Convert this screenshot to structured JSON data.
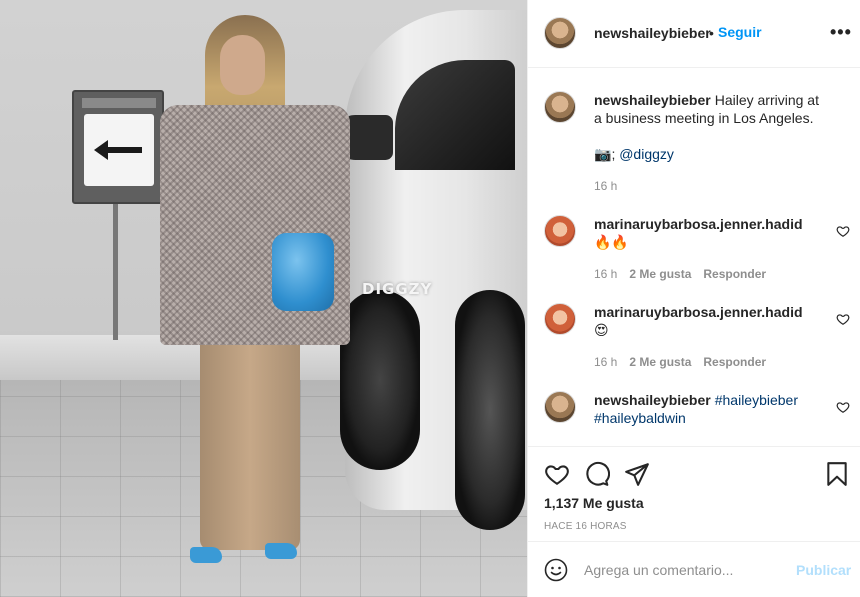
{
  "photo": {
    "watermark": "DIGGZY",
    "alt": "post-photo"
  },
  "header": {
    "username": "newshaileybieber",
    "separator": "•",
    "follow_label": "Seguir",
    "more_label": "•••"
  },
  "caption": {
    "username": "newshaileybieber",
    "text": "Hailey arriving at a business meeting in Los Angeles.",
    "credit_icon": "📷",
    "credit_sep": ";",
    "credit_handle": "@diggzy",
    "time": "16 h"
  },
  "comments": [
    {
      "username": "marinaruybarbosa.jenner.hadid",
      "text": "🔥🔥",
      "time": "16 h",
      "likes": "2 Me gusta",
      "reply_label": "Responder"
    },
    {
      "username": "marinaruybarbosa.jenner.hadid",
      "text": "😍",
      "time": "16 h",
      "likes": "2 Me gusta",
      "reply_label": "Responder"
    },
    {
      "username": "newshaileybieber",
      "tag1": "#haileybieber",
      "tag2": "#haileybaldwin"
    }
  ],
  "actions": {
    "icons": [
      "heart-icon",
      "comment-icon",
      "share-icon",
      "bookmark-icon"
    ],
    "likes": "1,137 Me gusta",
    "time_ago": "HACE 16 HORAS"
  },
  "add_comment": {
    "placeholder": "Agrega un comentario...",
    "publish_label": "Publicar"
  },
  "colors": {
    "accent": "#0095f6",
    "text": "#262626",
    "muted": "#8e8e8e",
    "link": "#00376b",
    "publish_disabled": "#b2dffc"
  }
}
